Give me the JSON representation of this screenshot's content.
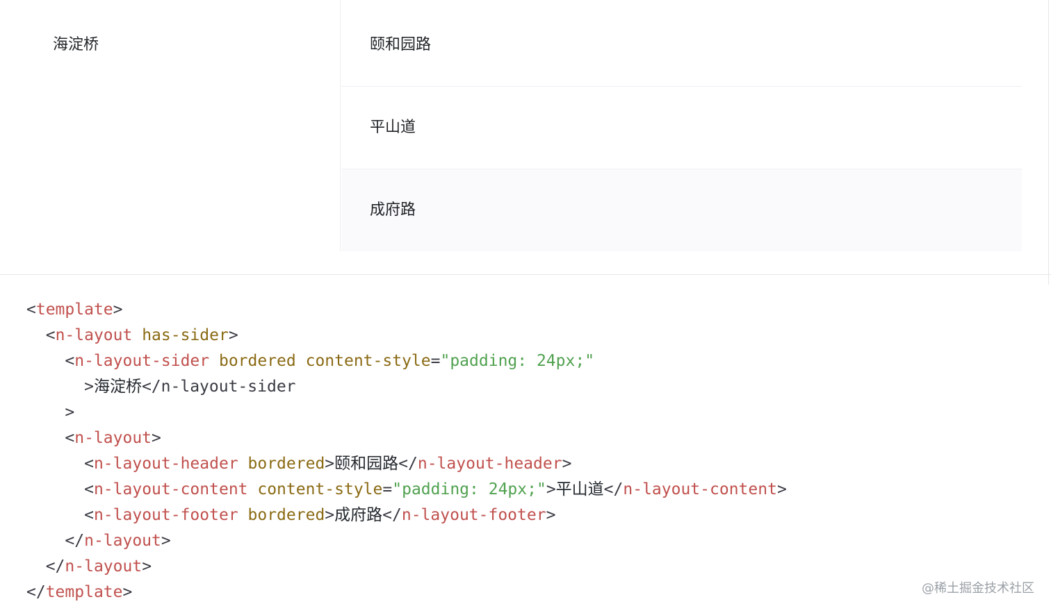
{
  "demo": {
    "sider_text": "海淀桥",
    "header_text": "颐和园路",
    "content_text": "平山道",
    "footer_text": "成府路"
  },
  "code": {
    "lines": [
      [
        {
          "t": "<",
          "k": "punct"
        },
        {
          "t": "template",
          "k": "tag"
        },
        {
          "t": ">",
          "k": "punct"
        }
      ],
      [
        {
          "t": "  ",
          "k": "punct"
        },
        {
          "t": "<",
          "k": "punct"
        },
        {
          "t": "n-layout",
          "k": "tag"
        },
        {
          "t": " has-sider",
          "k": "attr"
        },
        {
          "t": ">",
          "k": "punct"
        }
      ],
      [
        {
          "t": "    ",
          "k": "punct"
        },
        {
          "t": "<",
          "k": "punct"
        },
        {
          "t": "n-layout-sider",
          "k": "tag"
        },
        {
          "t": " bordered",
          "k": "attr"
        },
        {
          "t": " content-style",
          "k": "attr"
        },
        {
          "t": "=",
          "k": "punct"
        },
        {
          "t": "\"padding: 24px;\"",
          "k": "str"
        }
      ],
      [
        {
          "t": "      ",
          "k": "punct"
        },
        {
          "t": ">",
          "k": "punct"
        },
        {
          "t": "海淀桥",
          "k": "text"
        },
        {
          "t": "</",
          "k": "punct"
        },
        {
          "t": "n-layout-sider",
          "k": "punct"
        }
      ],
      [
        {
          "t": "    ",
          "k": "punct"
        },
        {
          "t": ">",
          "k": "punct"
        }
      ],
      [
        {
          "t": "    ",
          "k": "punct"
        },
        {
          "t": "<",
          "k": "punct"
        },
        {
          "t": "n-layout",
          "k": "tag"
        },
        {
          "t": ">",
          "k": "punct"
        }
      ],
      [
        {
          "t": "      ",
          "k": "punct"
        },
        {
          "t": "<",
          "k": "punct"
        },
        {
          "t": "n-layout-header",
          "k": "tag"
        },
        {
          "t": " bordered",
          "k": "attr"
        },
        {
          "t": ">",
          "k": "punct"
        },
        {
          "t": "颐和园路",
          "k": "text"
        },
        {
          "t": "</",
          "k": "punct"
        },
        {
          "t": "n-layout-header",
          "k": "tag"
        },
        {
          "t": ">",
          "k": "punct"
        }
      ],
      [
        {
          "t": "      ",
          "k": "punct"
        },
        {
          "t": "<",
          "k": "punct"
        },
        {
          "t": "n-layout-content",
          "k": "tag"
        },
        {
          "t": " content-style",
          "k": "attr"
        },
        {
          "t": "=",
          "k": "punct"
        },
        {
          "t": "\"padding: 24px;\"",
          "k": "str"
        },
        {
          "t": ">",
          "k": "punct"
        },
        {
          "t": "平山道",
          "k": "text"
        },
        {
          "t": "</",
          "k": "punct"
        },
        {
          "t": "n-layout-content",
          "k": "tag"
        },
        {
          "t": ">",
          "k": "punct"
        }
      ],
      [
        {
          "t": "      ",
          "k": "punct"
        },
        {
          "t": "<",
          "k": "punct"
        },
        {
          "t": "n-layout-footer",
          "k": "tag"
        },
        {
          "t": " bordered",
          "k": "attr"
        },
        {
          "t": ">",
          "k": "punct"
        },
        {
          "t": "成府路",
          "k": "text"
        },
        {
          "t": "</",
          "k": "punct"
        },
        {
          "t": "n-layout-footer",
          "k": "tag"
        },
        {
          "t": ">",
          "k": "punct"
        }
      ],
      [
        {
          "t": "    ",
          "k": "punct"
        },
        {
          "t": "</",
          "k": "punct"
        },
        {
          "t": "n-layout",
          "k": "tag"
        },
        {
          "t": ">",
          "k": "punct"
        }
      ],
      [
        {
          "t": "  ",
          "k": "punct"
        },
        {
          "t": "</",
          "k": "punct"
        },
        {
          "t": "n-layout",
          "k": "tag"
        },
        {
          "t": ">",
          "k": "punct"
        }
      ],
      [
        {
          "t": "</",
          "k": "punct"
        },
        {
          "t": "template",
          "k": "tag"
        },
        {
          "t": ">",
          "k": "punct"
        }
      ]
    ]
  },
  "watermark": "@稀土掘金技术社区",
  "colors": {
    "tag": "#c0504d",
    "attr": "#8a6a14",
    "string": "#50a14f",
    "footer_bg": "#fafafc",
    "border": "#efeff5"
  }
}
